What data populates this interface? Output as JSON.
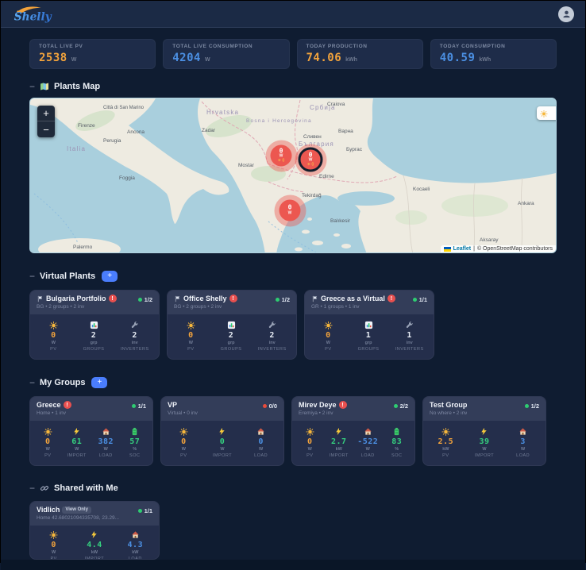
{
  "header": {
    "logo_text": "Shelly"
  },
  "colors": {
    "production_orange": "#f2a33c",
    "consumption_blue": "#4b8fe2",
    "import_green": "#35d07f",
    "alert_red": "#e8504f",
    "status_green": "#2ecc71",
    "status_red": "#e74c3c",
    "accent_blue": "#4a7dfc",
    "marker_red": "#ec5750"
  },
  "stats_cards": [
    {
      "label": "TOTAL LIVE PV",
      "value": "2538",
      "unit": "W"
    },
    {
      "label": "TOTAL LIVE CONSUMPTION",
      "value": "4204",
      "unit": "W"
    },
    {
      "label": "TODAY PRODUCTION",
      "value": "74.06",
      "unit": "kWh"
    },
    {
      "label": "TODAY CONSUMPTION",
      "value": "40.59",
      "unit": "kWh"
    }
  ],
  "map": {
    "section_title": "Plants Map",
    "collapse_icon": "−",
    "zoom_in": "+",
    "zoom_out": "−",
    "attribution": {
      "leaflet": "Leaflet",
      "separator": "|",
      "osm": "© OpenStreetMap contributors"
    },
    "markers": [
      {
        "value": "0",
        "unit": "W",
        "extra": "☀ 0",
        "selected": false
      },
      {
        "value": "0",
        "unit": "W",
        "extra": "☀ 0",
        "selected": true
      },
      {
        "value": "0",
        "unit": "W",
        "extra": "",
        "selected": false
      }
    ],
    "labels": {
      "countries": [
        "Hrvatska",
        "Bosna i Hercegovina",
        "Србија",
        "България",
        "Italia"
      ],
      "cities": [
        "Città di San Marino",
        "Firenze",
        "Perugia",
        "Ancona",
        "Zadar",
        "Mostar",
        "Palermo",
        "Варна",
        "Бургас",
        "Craiova",
        "Tekirdağ",
        "Balıkesir",
        "Kocaeli",
        "Ankara",
        "Aksaray",
        "Сливен",
        "Foggia",
        "Edirne"
      ]
    }
  },
  "virtual_plants": {
    "section_title": "Virtual Plants",
    "collapse_icon": "−",
    "add_button": "+",
    "cards": [
      {
        "title": "Bulgaria Portfolio",
        "alert": "!",
        "subtitle": "BG • 2 groups • 2 inv",
        "status": "1/2",
        "stats": [
          {
            "value": "0",
            "unit": "W",
            "label": "PV"
          },
          {
            "value": "2",
            "unit": "grp",
            "label": "GROUPS"
          },
          {
            "value": "2",
            "unit": "inv",
            "label": "INVERTERS"
          }
        ]
      },
      {
        "title": "Office Shelly",
        "alert": "!",
        "subtitle": "BG • 2 groups • 2 inv",
        "status": "1/2",
        "stats": [
          {
            "value": "0",
            "unit": "W",
            "label": "PV"
          },
          {
            "value": "2",
            "unit": "grp",
            "label": "GROUPS"
          },
          {
            "value": "2",
            "unit": "inv",
            "label": "INVERTERS"
          }
        ]
      },
      {
        "title": "Greece as a Virtual",
        "alert": "!",
        "subtitle": "GR • 1 groups • 1 inv",
        "status": "1/1",
        "stats": [
          {
            "value": "0",
            "unit": "W",
            "label": "PV"
          },
          {
            "value": "1",
            "unit": "grp",
            "label": "GROUPS"
          },
          {
            "value": "1",
            "unit": "inv",
            "label": "INVERTERS"
          }
        ]
      }
    ]
  },
  "my_groups": {
    "section_title": "My Groups",
    "collapse_icon": "−",
    "add_button": "+",
    "cards": [
      {
        "title": "Greece",
        "alert": "!",
        "subtitle": "Home • 1 inv",
        "status": "1/1",
        "stats": [
          {
            "value": "0",
            "unit": "W",
            "label": "PV"
          },
          {
            "value": "61",
            "unit": "W",
            "label": "IMPORT"
          },
          {
            "value": "382",
            "unit": "W",
            "label": "LOAD"
          },
          {
            "value": "57",
            "unit": "%",
            "label": "SOC"
          }
        ]
      },
      {
        "title": "VP",
        "subtitle": "Virtual • 0 inv",
        "status": "0/0",
        "stats": [
          {
            "value": "0",
            "unit": "W",
            "label": "PV"
          },
          {
            "value": "0",
            "unit": "W",
            "label": "IMPORT"
          },
          {
            "value": "0",
            "unit": "W",
            "label": "LOAD"
          }
        ]
      },
      {
        "title": "Mirev Deye",
        "alert": "!",
        "subtitle": "Eremiya • 2 inv",
        "status": "2/2",
        "stats": [
          {
            "value": "0",
            "unit": "W",
            "label": "PV"
          },
          {
            "value": "2.7",
            "unit": "kW",
            "label": "IMPORT"
          },
          {
            "value": "-522",
            "unit": "W",
            "label": "LOAD"
          },
          {
            "value": "83",
            "unit": "%",
            "label": "SOC"
          }
        ]
      },
      {
        "title": "Test Group",
        "subtitle": "No where • 2 inv",
        "status": "1/2",
        "stats": [
          {
            "value": "2.5",
            "unit": "kW",
            "label": "PV"
          },
          {
            "value": "39",
            "unit": "W",
            "label": "IMPORT"
          },
          {
            "value": "3",
            "unit": "W",
            "label": "LOAD"
          }
        ]
      }
    ]
  },
  "shared": {
    "section_title": "Shared with Me",
    "collapse_icon": "−",
    "cards": [
      {
        "title": "Vidlich",
        "badge": "View Only",
        "subtitle": "Home 42.68021094335708, 23.29...",
        "status": "1/1",
        "stats": [
          {
            "value": "0",
            "unit": "W",
            "label": "PV"
          },
          {
            "value": "4.4",
            "unit": "kW",
            "label": "IMPORT"
          },
          {
            "value": "4.3",
            "unit": "kW",
            "label": "LOAD"
          }
        ]
      }
    ]
  }
}
